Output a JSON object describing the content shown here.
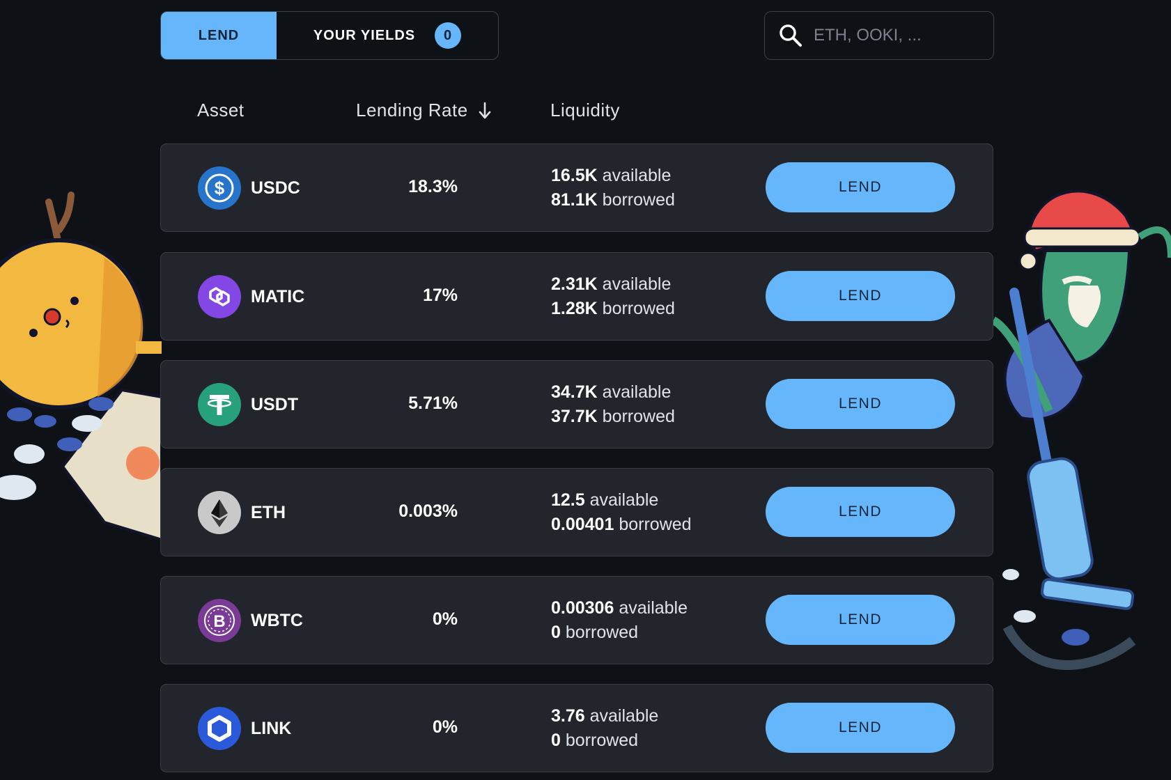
{
  "tabs": {
    "lend_label": "LEND",
    "yields_label": "YOUR YIELDS",
    "yields_count": "0"
  },
  "search": {
    "placeholder": "ETH, OOKI, ..."
  },
  "table_headers": {
    "asset": "Asset",
    "lending_rate": "Lending Rate",
    "liquidity": "Liquidity"
  },
  "rows": [
    {
      "asset": "USDC",
      "icon": "usdc-icon",
      "rate": "18.3%",
      "available": "16.5K",
      "available_suffix": "available",
      "borrowed": "81.1K",
      "borrowed_suffix": "borrowed",
      "button": "LEND"
    },
    {
      "asset": "MATIC",
      "icon": "matic-icon",
      "rate": "17%",
      "available": "2.31K",
      "available_suffix": "available",
      "borrowed": "1.28K",
      "borrowed_suffix": "borrowed",
      "button": "LEND"
    },
    {
      "asset": "USDT",
      "icon": "usdt-icon",
      "rate": "5.71%",
      "available": "34.7K",
      "available_suffix": "available",
      "borrowed": "37.7K",
      "borrowed_suffix": "borrowed",
      "button": "LEND"
    },
    {
      "asset": "ETH",
      "icon": "eth-icon",
      "rate": "0.003%",
      "available": "12.5",
      "available_suffix": "available",
      "borrowed": "0.00401",
      "borrowed_suffix": "borrowed",
      "button": "LEND"
    },
    {
      "asset": "WBTC",
      "icon": "wbtc-icon",
      "rate": "0%",
      "available": "0.00306",
      "available_suffix": "available",
      "borrowed": "0",
      "borrowed_suffix": "borrowed",
      "button": "LEND"
    },
    {
      "asset": "LINK",
      "icon": "link-icon",
      "rate": "0%",
      "available": "3.76",
      "available_suffix": "available",
      "borrowed": "0",
      "borrowed_suffix": "borrowed",
      "button": "LEND"
    }
  ],
  "colors": {
    "background": "#0e1116",
    "row_background": "#23252c",
    "accent": "#66b6fb",
    "usdc": "#2775ca",
    "matic": "#8247e5",
    "usdt": "#26a17b",
    "eth": "#c9c9c9",
    "wbtc": "#7a3b96",
    "link": "#2a5ada"
  }
}
